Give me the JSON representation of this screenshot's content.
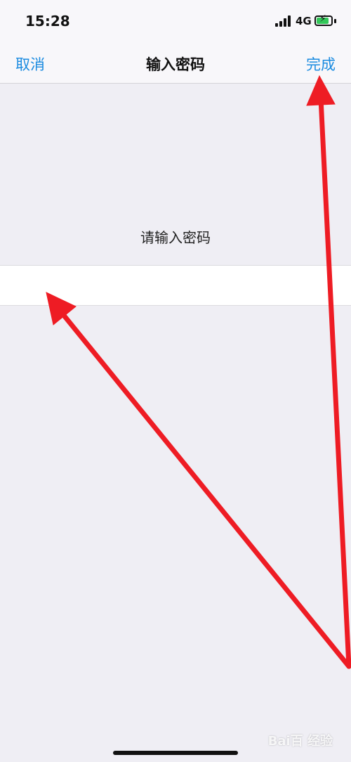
{
  "status_bar": {
    "time": "15:28",
    "network": "4G",
    "battery_charging": true
  },
  "nav": {
    "cancel_label": "取消",
    "title": "输入密码",
    "done_label": "完成"
  },
  "content": {
    "prompt": "请输入密码",
    "password_value": "",
    "password_placeholder": ""
  },
  "annotation_color": "#ee1c24",
  "accent_color": "#1a8be0",
  "watermark_text": "Bai百 经验"
}
